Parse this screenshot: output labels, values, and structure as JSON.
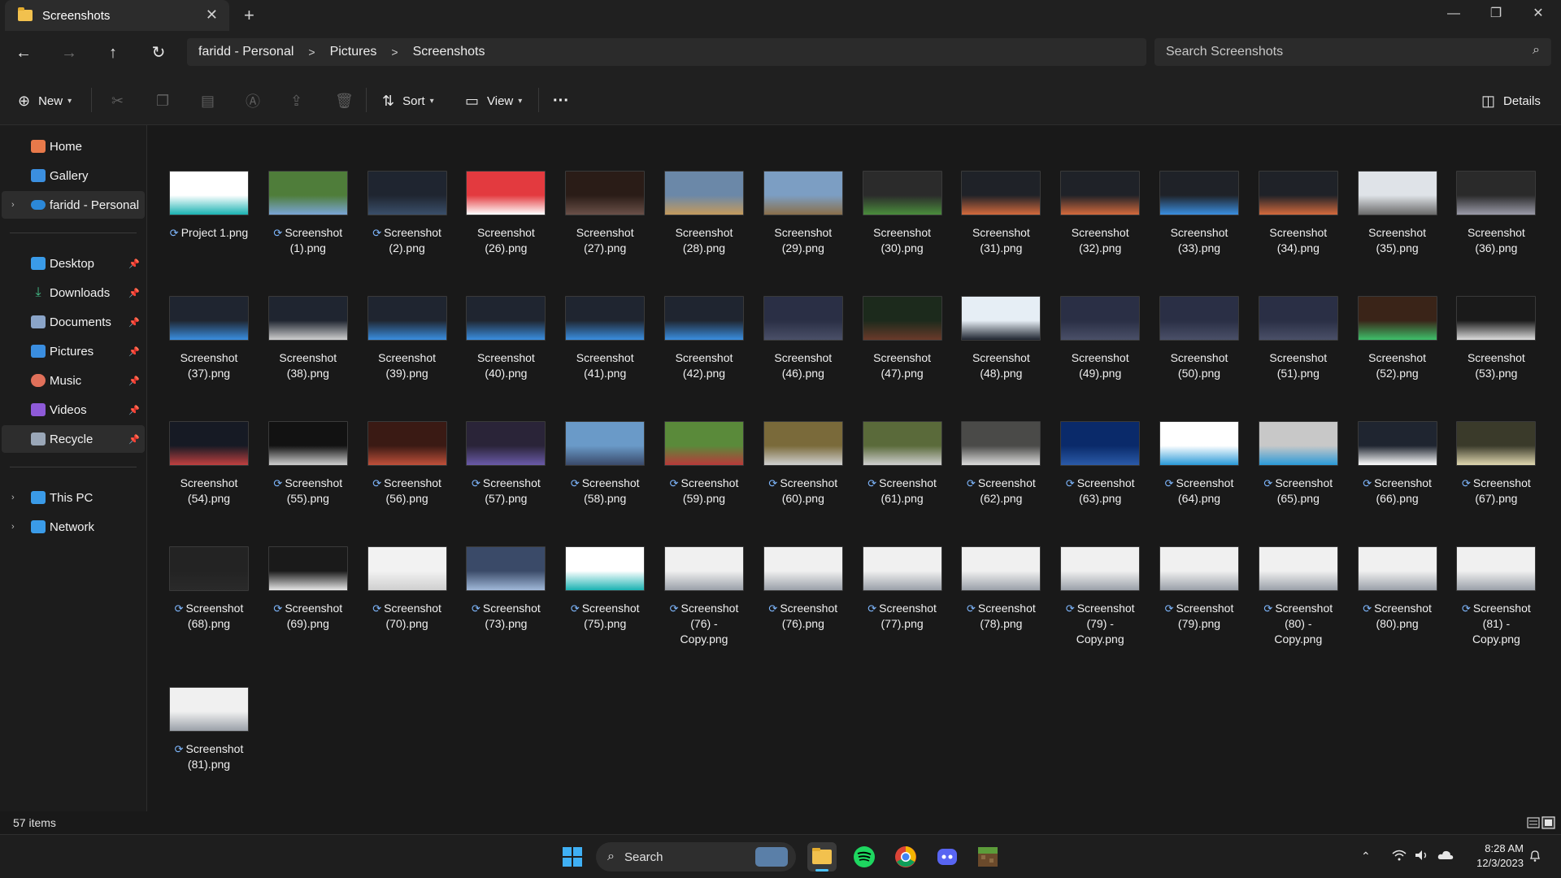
{
  "window": {
    "tab_title": "Screenshots",
    "controls": {
      "minimize": "—",
      "maximize": "❐",
      "close": "✕"
    }
  },
  "nav": {
    "breadcrumb": [
      "faridd - Personal",
      "Pictures",
      "Screenshots"
    ],
    "search_placeholder": "Search Screenshots"
  },
  "toolbar": {
    "new_label": "New",
    "sort_label": "Sort",
    "view_label": "View",
    "more_label": "···",
    "details_label": "Details"
  },
  "sidebar": {
    "top_items": [
      {
        "label": "Home",
        "icon": "home-icon"
      },
      {
        "label": "Gallery",
        "icon": "gallery-icon"
      },
      {
        "label": "faridd - Personal",
        "icon": "onedrive-icon"
      }
    ],
    "pinned_items": [
      {
        "label": "Desktop",
        "icon": "desktop-icon"
      },
      {
        "label": "Downloads",
        "icon": "downloads-icon"
      },
      {
        "label": "Documents",
        "icon": "documents-icon"
      },
      {
        "label": "Pictures",
        "icon": "pictures-icon"
      },
      {
        "label": "Music",
        "icon": "music-icon"
      },
      {
        "label": "Videos",
        "icon": "videos-icon"
      },
      {
        "label": "Recycle",
        "icon": "recycle-bin-icon"
      }
    ],
    "bottom_items": [
      {
        "label": "This PC",
        "icon": "this-pc-icon"
      },
      {
        "label": "Network",
        "icon": "network-icon"
      }
    ]
  },
  "files": [
    {
      "line1": "Project 1.png",
      "line2": "",
      "line3": "",
      "sync": true
    },
    {
      "line1": "Screenshot",
      "line2": "(1).png",
      "line3": "",
      "sync": true
    },
    {
      "line1": "Screenshot",
      "line2": "(2).png",
      "line3": "",
      "sync": true
    },
    {
      "line1": "Screenshot",
      "line2": "(26).png",
      "line3": "",
      "sync": false
    },
    {
      "line1": "Screenshot",
      "line2": "(27).png",
      "line3": "",
      "sync": false
    },
    {
      "line1": "Screenshot",
      "line2": "(28).png",
      "line3": "",
      "sync": false
    },
    {
      "line1": "Screenshot",
      "line2": "(29).png",
      "line3": "",
      "sync": false
    },
    {
      "line1": "Screenshot",
      "line2": "(30).png",
      "line3": "",
      "sync": false
    },
    {
      "line1": "Screenshot",
      "line2": "(31).png",
      "line3": "",
      "sync": false
    },
    {
      "line1": "Screenshot",
      "line2": "(32).png",
      "line3": "",
      "sync": false
    },
    {
      "line1": "Screenshot",
      "line2": "(33).png",
      "line3": "",
      "sync": false
    },
    {
      "line1": "Screenshot",
      "line2": "(34).png",
      "line3": "",
      "sync": false
    },
    {
      "line1": "Screenshot",
      "line2": "(35).png",
      "line3": "",
      "sync": false
    },
    {
      "line1": "Screenshot",
      "line2": "(36).png",
      "line3": "",
      "sync": false
    },
    {
      "line1": "Screenshot",
      "line2": "(37).png",
      "line3": "",
      "sync": false
    },
    {
      "line1": "Screenshot",
      "line2": "(38).png",
      "line3": "",
      "sync": false
    },
    {
      "line1": "Screenshot",
      "line2": "(39).png",
      "line3": "",
      "sync": false
    },
    {
      "line1": "Screenshot",
      "line2": "(40).png",
      "line3": "",
      "sync": false
    },
    {
      "line1": "Screenshot",
      "line2": "(41).png",
      "line3": "",
      "sync": false
    },
    {
      "line1": "Screenshot",
      "line2": "(42).png",
      "line3": "",
      "sync": false
    },
    {
      "line1": "Screenshot",
      "line2": "(46).png",
      "line3": "",
      "sync": false
    },
    {
      "line1": "Screenshot",
      "line2": "(47).png",
      "line3": "",
      "sync": false
    },
    {
      "line1": "Screenshot",
      "line2": "(48).png",
      "line3": "",
      "sync": false
    },
    {
      "line1": "Screenshot",
      "line2": "(49).png",
      "line3": "",
      "sync": false
    },
    {
      "line1": "Screenshot",
      "line2": "(50).png",
      "line3": "",
      "sync": false
    },
    {
      "line1": "Screenshot",
      "line2": "(51).png",
      "line3": "",
      "sync": false
    },
    {
      "line1": "Screenshot",
      "line2": "(52).png",
      "line3": "",
      "sync": false
    },
    {
      "line1": "Screenshot",
      "line2": "(53).png",
      "line3": "",
      "sync": false
    },
    {
      "line1": "Screenshot",
      "line2": "(54).png",
      "line3": "",
      "sync": false
    },
    {
      "line1": "Screenshot",
      "line2": "(55).png",
      "line3": "",
      "sync": true
    },
    {
      "line1": "Screenshot",
      "line2": "(56).png",
      "line3": "",
      "sync": true
    },
    {
      "line1": "Screenshot",
      "line2": "(57).png",
      "line3": "",
      "sync": true
    },
    {
      "line1": "Screenshot",
      "line2": "(58).png",
      "line3": "",
      "sync": true
    },
    {
      "line1": "Screenshot",
      "line2": "(59).png",
      "line3": "",
      "sync": true
    },
    {
      "line1": "Screenshot",
      "line2": "(60).png",
      "line3": "",
      "sync": true
    },
    {
      "line1": "Screenshot",
      "line2": "(61).png",
      "line3": "",
      "sync": true
    },
    {
      "line1": "Screenshot",
      "line2": "(62).png",
      "line3": "",
      "sync": true
    },
    {
      "line1": "Screenshot",
      "line2": "(63).png",
      "line3": "",
      "sync": true
    },
    {
      "line1": "Screenshot",
      "line2": "(64).png",
      "line3": "",
      "sync": true
    },
    {
      "line1": "Screenshot",
      "line2": "(65).png",
      "line3": "",
      "sync": true
    },
    {
      "line1": "Screenshot",
      "line2": "(66).png",
      "line3": "",
      "sync": true
    },
    {
      "line1": "Screenshot",
      "line2": "(67).png",
      "line3": "",
      "sync": true
    },
    {
      "line1": "Screenshot",
      "line2": "(68).png",
      "line3": "",
      "sync": true
    },
    {
      "line1": "Screenshot",
      "line2": "(69).png",
      "line3": "",
      "sync": true
    },
    {
      "line1": "Screenshot",
      "line2": "(70).png",
      "line3": "",
      "sync": true
    },
    {
      "line1": "Screenshot",
      "line2": "(73).png",
      "line3": "",
      "sync": true
    },
    {
      "line1": "Screenshot",
      "line2": "(75).png",
      "line3": "",
      "sync": true
    },
    {
      "line1": "Screenshot",
      "line2": "(76) -",
      "line3": "Copy.png",
      "sync": true
    },
    {
      "line1": "Screenshot",
      "line2": "(76).png",
      "line3": "",
      "sync": true
    },
    {
      "line1": "Screenshot",
      "line2": "(77).png",
      "line3": "",
      "sync": true
    },
    {
      "line1": "Screenshot",
      "line2": "(78).png",
      "line3": "",
      "sync": true
    },
    {
      "line1": "Screenshot",
      "line2": "(79) -",
      "line3": "Copy.png",
      "sync": true
    },
    {
      "line1": "Screenshot",
      "line2": "(79).png",
      "line3": "",
      "sync": true
    },
    {
      "line1": "Screenshot",
      "line2": "(80) -",
      "line3": "Copy.png",
      "sync": true
    },
    {
      "line1": "Screenshot",
      "line2": "(80).png",
      "line3": "",
      "sync": true
    },
    {
      "line1": "Screenshot",
      "line2": "(81) -",
      "line3": "Copy.png",
      "sync": true
    },
    {
      "line1": "Screenshot",
      "line2": "(81).png",
      "line3": "",
      "sync": true
    }
  ],
  "status": {
    "item_count": "57 items"
  },
  "taskbar": {
    "search_label": "Search",
    "time": "8:28 AM",
    "date": "12/3/2023"
  },
  "colors": {
    "accent": "#4cc2ff",
    "background": "#191919",
    "toolbar": "#202020",
    "sync_icon": "#7fb8ff"
  }
}
